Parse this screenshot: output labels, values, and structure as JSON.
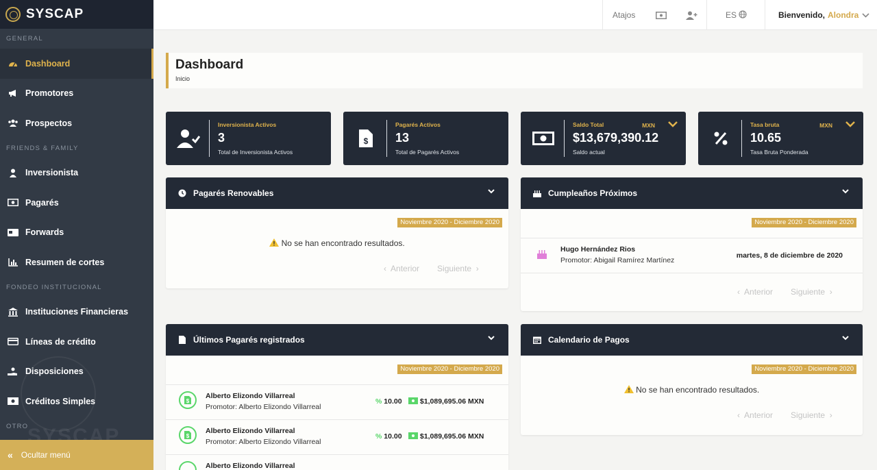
{
  "brand": {
    "name": "SYSCAP",
    "watermark": "SYSCAP"
  },
  "sidebar": {
    "sections": {
      "general": "GENERAL",
      "friends": "FRIENDS & FAMILY",
      "fondeo": "FONDEO INSTITUCIONAL",
      "otro": "OTRO"
    },
    "items": [
      {
        "label": "Dashboard",
        "icon": "gauge-icon"
      },
      {
        "label": "Promotores",
        "icon": "megaphone-icon"
      },
      {
        "label": "Prospectos",
        "icon": "users-icon"
      },
      {
        "label": "Inversionista",
        "icon": "user-tie-icon"
      },
      {
        "label": "Pagarés",
        "icon": "money-bill-icon"
      },
      {
        "label": "Forwards",
        "icon": "cash-card-icon"
      },
      {
        "label": "Resumen de cortes",
        "icon": "bar-chart-icon"
      },
      {
        "label": "Instituciones Financieras",
        "icon": "bank-icon"
      },
      {
        "label": "Líneas de crédito",
        "icon": "credit-card-icon"
      },
      {
        "label": "Disposiciones",
        "icon": "hand-money-icon"
      },
      {
        "label": "Créditos Simples",
        "icon": "money-icon"
      }
    ],
    "footer": "Ocultar menú"
  },
  "topbar": {
    "shortcuts": "Atajos",
    "lang": "ES",
    "welcome": "Bienvenido,",
    "user": "Alondra"
  },
  "page": {
    "title": "Dashboard",
    "breadcrumb": "Inicio"
  },
  "stats": [
    {
      "label": "Inversionista Activos",
      "value": "3",
      "sub": "Total de Inversionista Activos"
    },
    {
      "label": "Pagarés Activos",
      "value": "13",
      "sub": "Total de Pagarés Activos"
    },
    {
      "label": "Saldo Total",
      "value": "$13,679,390.12",
      "sub": "Saldo actual",
      "currency": "MXN"
    },
    {
      "label": "Tasa bruta",
      "value": "10.65",
      "sub": "Tasa Bruta Ponderada",
      "currency": "MXN"
    }
  ],
  "panels": {
    "renovables": {
      "title": "Pagarés Renovables",
      "range": "Noviembre 2020 - Diciembre 2020",
      "empty": "No se han encontrado resultados.",
      "prev": "Anterior",
      "next": "Siguiente"
    },
    "cumple": {
      "title": "Cumpleaños Próximos",
      "range": "Noviembre 2020 - Diciembre 2020",
      "name": "Hugo Hernández Rios",
      "promotor": "Promotor: Abigail Ramírez Martínez",
      "date": "martes, 8 de diciembre de 2020",
      "prev": "Anterior",
      "next": "Siguiente"
    },
    "ultimos": {
      "title": "Últimos Pagarés registrados",
      "range": "Noviembre 2020 - Diciembre 2020",
      "rows": [
        {
          "name": "Alberto Elizondo Villarreal",
          "promotor": "Promotor: Alberto Elizondo Villarreal",
          "rate": "10.00",
          "amount": "$1,089,695.06 MXN"
        },
        {
          "name": "Alberto Elizondo Villarreal",
          "promotor": "Promotor: Alberto Elizondo Villarreal",
          "rate": "10.00",
          "amount": "$1,089,695.06 MXN"
        },
        {
          "name": "Alberto Elizondo Villarreal"
        }
      ]
    },
    "calendario": {
      "title": "Calendario de Pagos",
      "range": "Noviembre 2020 - Diciembre 2020",
      "empty": "No se han encontrado resultados.",
      "prev": "Anterior",
      "next": "Siguiente"
    }
  },
  "colors": {
    "accent": "#d4a94c",
    "dark": "#232a36",
    "sidebar": "#323a45",
    "success": "#5ad66a"
  }
}
